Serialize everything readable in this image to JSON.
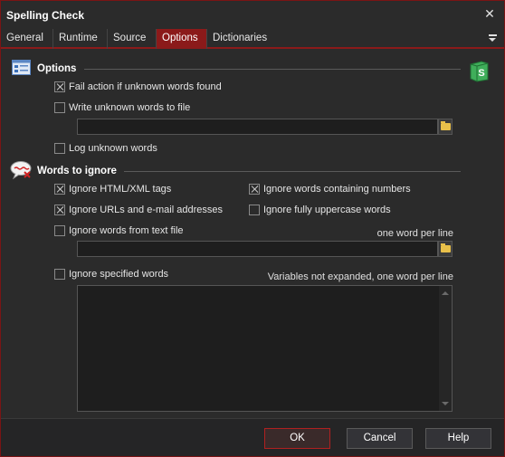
{
  "window": {
    "title": "Spelling Check"
  },
  "tabs": [
    {
      "label": "General"
    },
    {
      "label": "Runtime"
    },
    {
      "label": "Source"
    },
    {
      "label": "Options",
      "active": true
    },
    {
      "label": "Dictionaries"
    }
  ],
  "options": {
    "header": "Options",
    "fail_action": {
      "label": "Fail action if unknown words found",
      "checked": true
    },
    "write_unknown": {
      "label": "Write unknown words to file",
      "checked": false,
      "value": ""
    },
    "log_unknown": {
      "label": "Log unknown words",
      "checked": false
    }
  },
  "words_to_ignore": {
    "header": "Words to ignore",
    "html_xml": {
      "label": "Ignore HTML/XML tags",
      "checked": true
    },
    "numbers": {
      "label": "Ignore words containing numbers",
      "checked": true
    },
    "urls": {
      "label": "Ignore URLs and e-mail addresses",
      "checked": true
    },
    "uppercase": {
      "label": "Ignore fully uppercase words",
      "checked": false
    },
    "text_file": {
      "label": "Ignore words from text file",
      "checked": false,
      "hint": "one word per line",
      "value": ""
    },
    "specified": {
      "label": "Ignore specified words",
      "checked": false,
      "hint": "Variables not expanded, one word per line",
      "value": ""
    }
  },
  "footer": {
    "ok": "OK",
    "cancel": "Cancel",
    "help": "Help"
  },
  "colors": {
    "accent": "#8b1a1a",
    "background": "#2b2b2b",
    "input_bg": "#1e1e1e"
  }
}
